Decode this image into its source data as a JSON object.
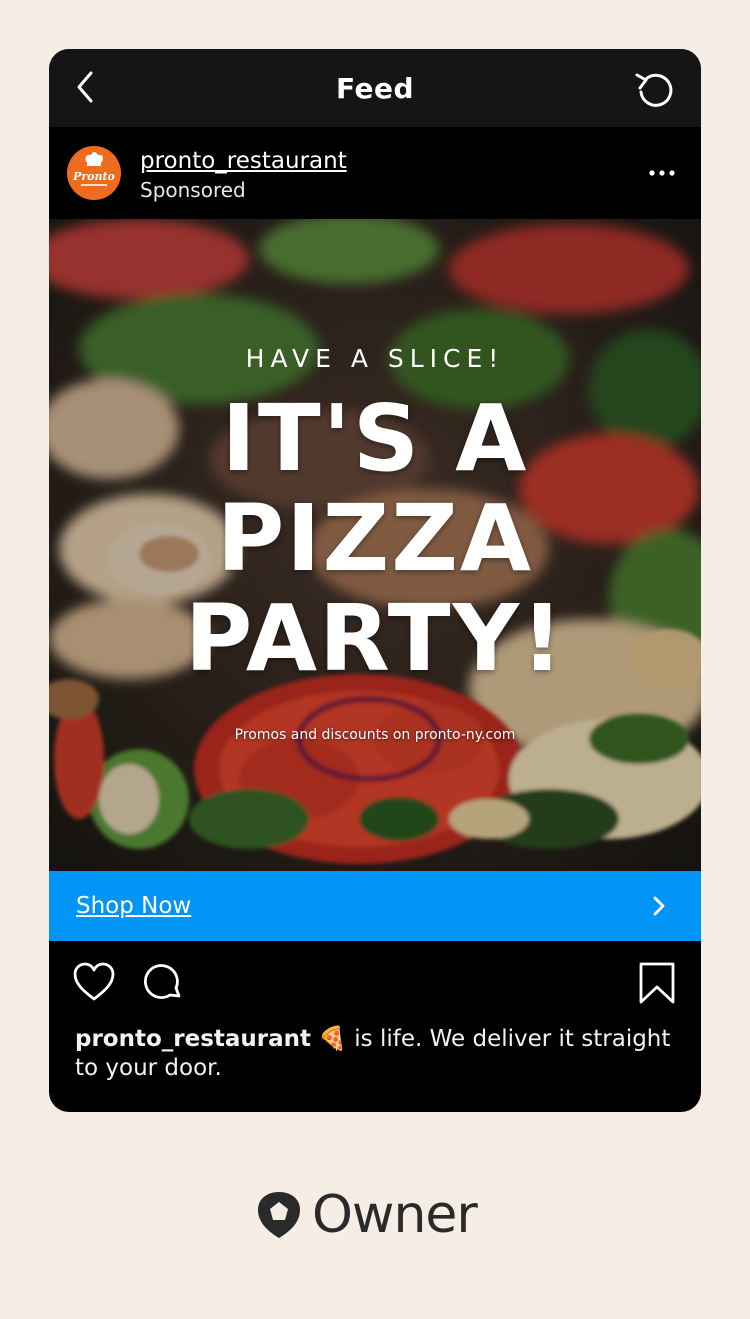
{
  "header": {
    "title": "Feed",
    "back_icon": "chevron-left-icon",
    "refresh_icon": "refresh-icon"
  },
  "post": {
    "username": "pronto_restaurant",
    "label": "Sponsored",
    "avatar_text": "Pronto",
    "more_icon": "more-horizontal-icon"
  },
  "ad": {
    "kicker": "HAVE A SLICE!",
    "headline_lines": [
      "IT'S A",
      "PIZZA",
      "PARTY!"
    ],
    "promo": "Promos and discounts on pronto-ny.com"
  },
  "cta": {
    "label": "Shop Now",
    "color": "#0095f6"
  },
  "caption": {
    "username": "pronto_restaurant",
    "emoji": "🍕",
    "text": "is life. We deliver it straight to your door."
  },
  "brand": {
    "name": "Owner"
  },
  "colors": {
    "page_bg": "#f6eee5",
    "avatar_bg": "#ee6b1f"
  }
}
